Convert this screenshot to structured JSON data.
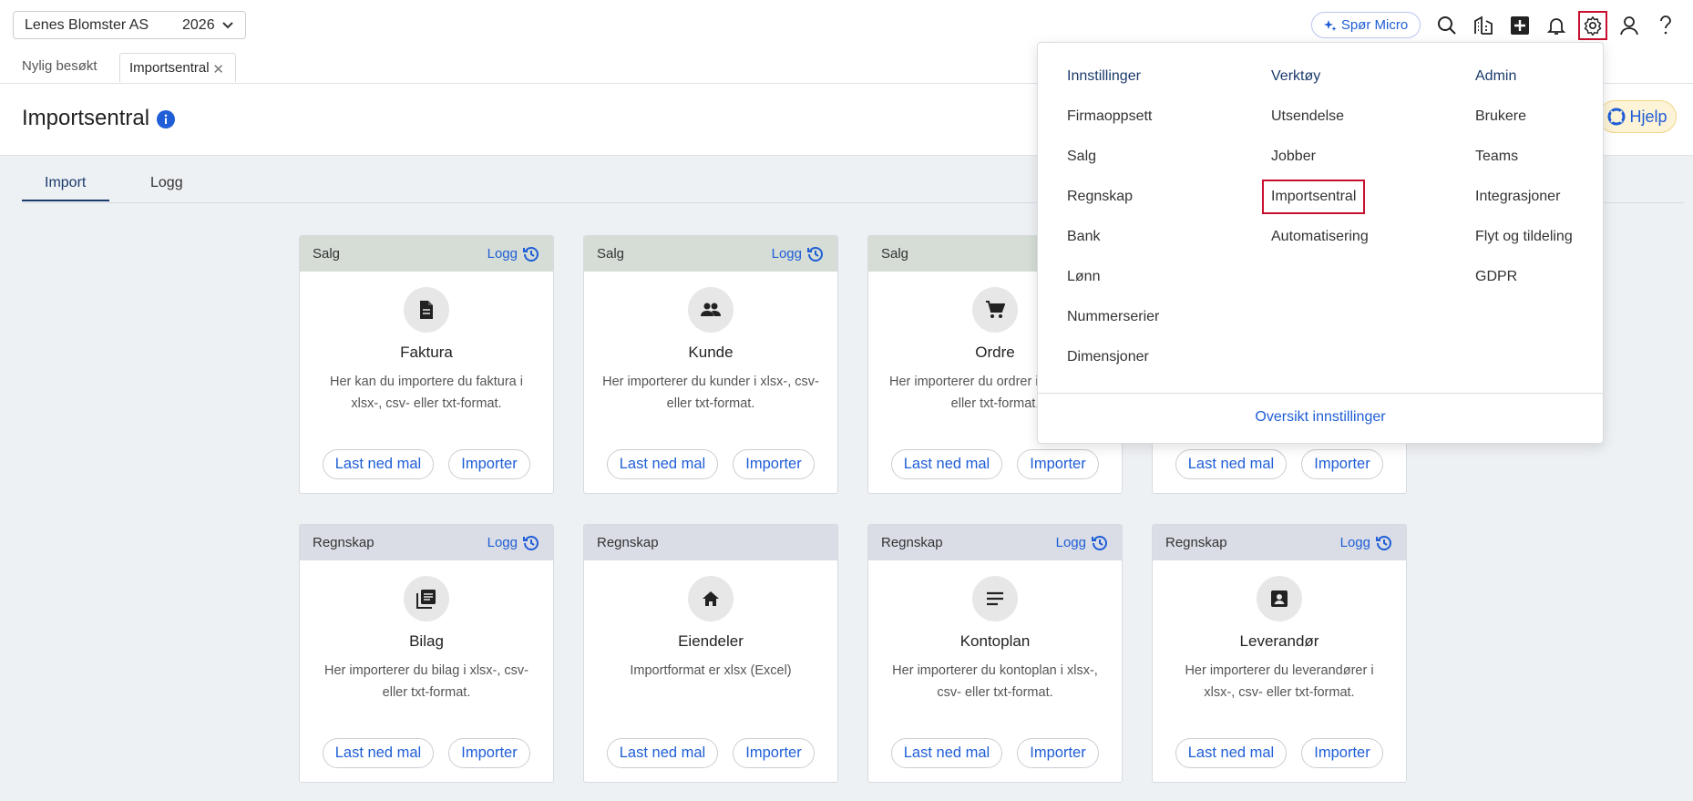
{
  "topbar": {
    "company": "Lenes Blomster AS",
    "year": "2026",
    "micro_label": "Spør Micro"
  },
  "tabs": {
    "recent": "Nylig besøkt",
    "open_tab": "Importsentral"
  },
  "page": {
    "title": "Importsentral",
    "help_label": "Hjelp"
  },
  "subtabs": [
    "Import",
    "Logg"
  ],
  "cards": [
    {
      "category": "Salg",
      "log": "Logg",
      "title": "Faktura",
      "desc": "Her kan du importere du faktura i xlsx-, csv- eller txt-format.",
      "download": "Last ned mal",
      "import": "Importer"
    },
    {
      "category": "Salg",
      "log": "Logg",
      "title": "Kunde",
      "desc": "Her importerer du kunder i xlsx-, csv- eller txt-format.",
      "download": "Last ned mal",
      "import": "Importer"
    },
    {
      "category": "Salg",
      "log": "",
      "title": "Ordre",
      "desc": "Her importerer du ordrer i xlsx-, csv- eller txt-format.",
      "download": "Last ned mal",
      "import": "Importer"
    },
    {
      "category": "",
      "log": "",
      "title": "",
      "desc": "",
      "download": "Last ned mal",
      "import": "Importer"
    },
    {
      "category": "Regnskap",
      "log": "Logg",
      "title": "Bilag",
      "desc": "Her importerer du bilag i xlsx-, csv- eller txt-format.",
      "download": "Last ned mal",
      "import": "Importer"
    },
    {
      "category": "Regnskap",
      "log": "",
      "title": "Eiendeler",
      "desc": "Importformat er xlsx (Excel)",
      "download": "Last ned mal",
      "import": "Importer"
    },
    {
      "category": "Regnskap",
      "log": "Logg",
      "title": "Kontoplan",
      "desc": "Her importerer du kontoplan i xlsx-, csv- eller txt-format.",
      "download": "Last ned mal",
      "import": "Importer"
    },
    {
      "category": "Regnskap",
      "log": "Logg",
      "title": "Leverandør",
      "desc": "Her importerer du leverandører i xlsx-, csv- eller txt-format.",
      "download": "Last ned mal",
      "import": "Importer"
    }
  ],
  "menu": {
    "columns": [
      {
        "heading": "Innstillinger",
        "items": [
          "Firmaoppsett",
          "Salg",
          "Regnskap",
          "Bank",
          "Lønn",
          "Nummerserier",
          "Dimensjoner"
        ]
      },
      {
        "heading": "Verktøy",
        "items": [
          "Utsendelse",
          "Jobber",
          "Importsentral",
          "Automatisering"
        ]
      },
      {
        "heading": "Admin",
        "items": [
          "Brukere",
          "Teams",
          "Integrasjoner",
          "Flyt og tildeling",
          "GDPR"
        ]
      }
    ],
    "footer": "Oversikt innstillinger"
  },
  "icons": [
    "search-icon",
    "company-icon",
    "add-icon",
    "bell-icon",
    "gear-icon",
    "user-icon",
    "help-icon"
  ],
  "colors": {
    "accent": "#1f5ed6",
    "highlight": "#c8102e",
    "heading": "#1a3a6b"
  }
}
